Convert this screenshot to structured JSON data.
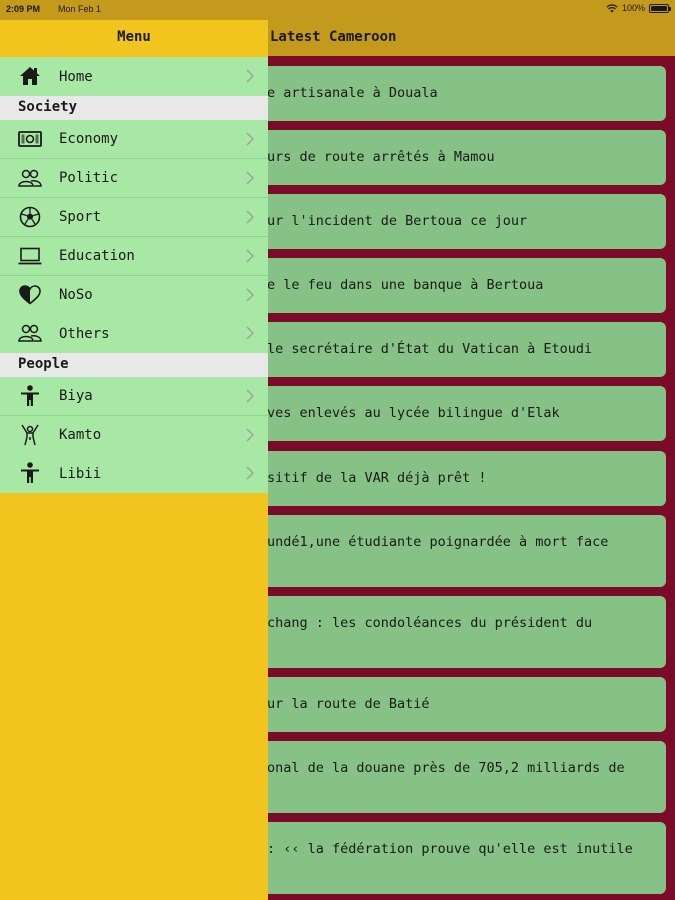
{
  "status_bar": {
    "time": "2:09 PM",
    "date": "Mon Feb 1",
    "battery": "100%"
  },
  "header": {
    "title": "Latest Cameroon"
  },
  "drawer": {
    "title": "Menu",
    "home": {
      "label": "Home",
      "icon": "home-icon"
    },
    "sections": [
      {
        "title": "Society",
        "items": [
          {
            "label": "Economy",
            "icon": "money-icon"
          },
          {
            "label": "Politic",
            "icon": "people-icon"
          },
          {
            "label": "Sport",
            "icon": "soccer-ball-icon"
          },
          {
            "label": "Education",
            "icon": "laptop-icon"
          },
          {
            "label": "NoSo",
            "icon": "heart-icon"
          },
          {
            "label": "Others",
            "icon": "people-icon"
          }
        ]
      },
      {
        "title": "People",
        "items": [
          {
            "label": "Biya",
            "icon": "person-icon"
          },
          {
            "label": "Kamto",
            "icon": "person-waving-icon"
          },
          {
            "label": "Libii",
            "icon": "person-icon"
          }
        ]
      }
    ]
  },
  "articles": [
    {
      "line1": "e artisanale à Douala",
      "line2": ""
    },
    {
      "line1": "urs de route arrêtés à Mamou",
      "line2": ""
    },
    {
      "line1": "ur l'incident de Bertoua ce jour",
      "line2": ""
    },
    {
      "line1": "e le feu dans une banque à Bertoua",
      "line2": ""
    },
    {
      "line1": " le secrétaire d'État du Vatican à Etoudi",
      "line2": ""
    },
    {
      "line1": "ves enlevés au lycée bilingue d'Elak",
      "line2": ""
    },
    {
      "line1": "sitif de la VAR déjà prêt !",
      "line2": ""
    },
    {
      "line1": "undé1,une étudiante poignardée à mort face",
      "line2": ""
    },
    {
      "line1": "chang : les condoléances du président du",
      "line2": ""
    },
    {
      "line1": "ur la route de Batié",
      "line2": ""
    },
    {
      "line1": "onal de la douane près de 705,2 milliards de",
      "line2": ""
    },
    {
      "line1": ": ‹‹ la fédération prouve qu'elle est inutile",
      "line2": ""
    }
  ],
  "colors": {
    "header": "#c49a1c",
    "drawer": "#f2c51e",
    "menu_row": "#a8e8a5",
    "card": "#86c285",
    "background": "#7a0c2a"
  }
}
